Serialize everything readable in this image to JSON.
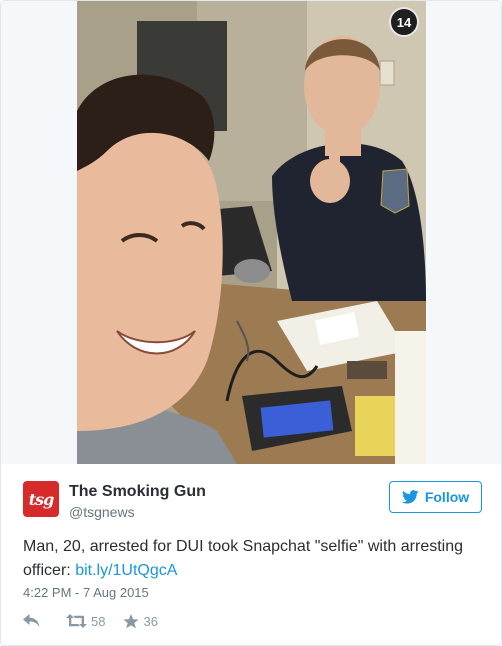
{
  "media": {
    "snap_counter": "14"
  },
  "author": {
    "avatar_text": "tsg",
    "name": "The Smoking Gun",
    "handle": "@tsgnews",
    "brand_color": "#d72b2b"
  },
  "follow": {
    "label": "Follow",
    "accent_color": "#1b95e0"
  },
  "tweet": {
    "text": "Man, 20, arrested for DUI took Snapchat \"selfie\" with arresting officer:",
    "link": "bit.ly/1UtQgcA",
    "timestamp": "4:22 PM - 7 Aug 2015"
  },
  "actions": {
    "reply_icon": "reply-icon",
    "retweet_icon": "retweet-icon",
    "retweet_count": "58",
    "like_icon": "star-icon",
    "like_count": "36"
  }
}
